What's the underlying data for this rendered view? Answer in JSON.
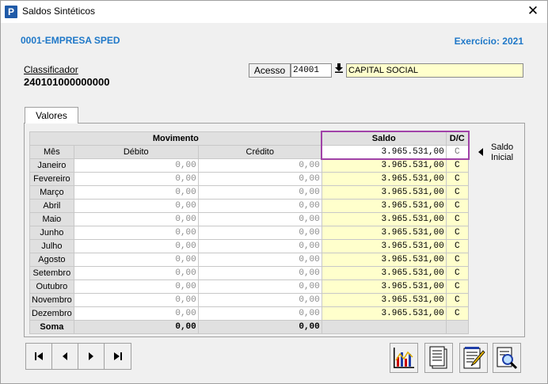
{
  "window": {
    "title": "Saldos Sintéticos",
    "app_icon_letter": "P"
  },
  "header": {
    "company": "0001-EMPRESA SPED",
    "exercise": "Exercício: 2021"
  },
  "classificador": {
    "label": "Classificador",
    "value": "240101000000000"
  },
  "acesso": {
    "label": "Acesso",
    "value": "24001",
    "account_name": "CAPITAL SOCIAL"
  },
  "tab": {
    "label": "Valores"
  },
  "grid": {
    "headers": {
      "movimento": "Movimento",
      "saldo": "Saldo",
      "dc": "D/C"
    },
    "subheaders": {
      "mes": "Mês",
      "debito": "Débito",
      "credito": "Crédito"
    },
    "saldo_inicial": {
      "value": "3.965.531,00",
      "dc": "C"
    },
    "rows": [
      {
        "month": "Janeiro",
        "debito": "0,00",
        "credito": "0,00",
        "saldo": "3.965.531,00",
        "dc": "C"
      },
      {
        "month": "Fevereiro",
        "debito": "0,00",
        "credito": "0,00",
        "saldo": "3.965.531,00",
        "dc": "C"
      },
      {
        "month": "Março",
        "debito": "0,00",
        "credito": "0,00",
        "saldo": "3.965.531,00",
        "dc": "C"
      },
      {
        "month": "Abril",
        "debito": "0,00",
        "credito": "0,00",
        "saldo": "3.965.531,00",
        "dc": "C"
      },
      {
        "month": "Maio",
        "debito": "0,00",
        "credito": "0,00",
        "saldo": "3.965.531,00",
        "dc": "C"
      },
      {
        "month": "Junho",
        "debito": "0,00",
        "credito": "0,00",
        "saldo": "3.965.531,00",
        "dc": "C"
      },
      {
        "month": "Julho",
        "debito": "0,00",
        "credito": "0,00",
        "saldo": "3.965.531,00",
        "dc": "C"
      },
      {
        "month": "Agosto",
        "debito": "0,00",
        "credito": "0,00",
        "saldo": "3.965.531,00",
        "dc": "C"
      },
      {
        "month": "Setembro",
        "debito": "0,00",
        "credito": "0,00",
        "saldo": "3.965.531,00",
        "dc": "C"
      },
      {
        "month": "Outubro",
        "debito": "0,00",
        "credito": "0,00",
        "saldo": "3.965.531,00",
        "dc": "C"
      },
      {
        "month": "Novembro",
        "debito": "0,00",
        "credito": "0,00",
        "saldo": "3.965.531,00",
        "dc": "C"
      },
      {
        "month": "Dezembro",
        "debito": "0,00",
        "credito": "0,00",
        "saldo": "3.965.531,00",
        "dc": "C"
      }
    ],
    "soma": {
      "label": "Soma",
      "debito": "0,00",
      "credito": "0,00"
    }
  },
  "saldo_inicial_label": {
    "line1": "Saldo",
    "line2": "Inicial"
  },
  "colors": {
    "accent_blue": "#1f78c8",
    "highlight_purple": "#a042a8",
    "field_yellow": "#ffffcc"
  }
}
